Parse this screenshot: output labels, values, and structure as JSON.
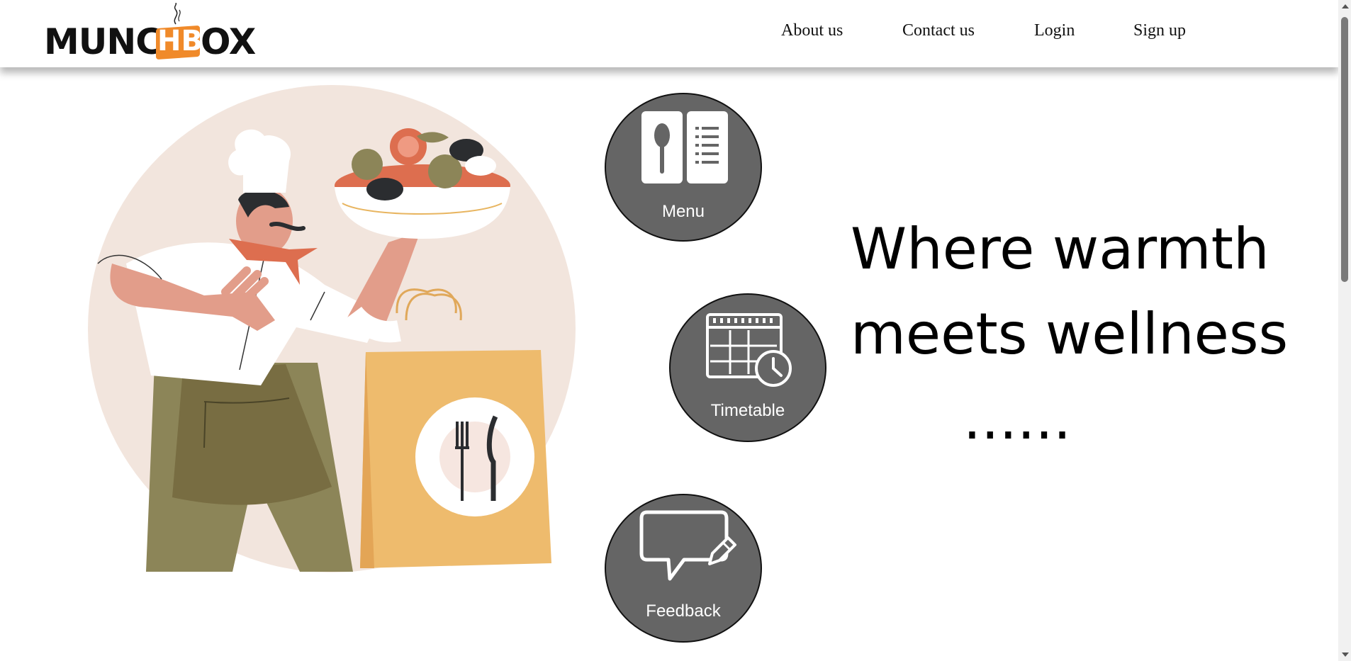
{
  "brand": {
    "name_left": "MUNC",
    "name_box": "HB",
    "name_right": "OX",
    "accent_color": "#f08a2a"
  },
  "nav": {
    "links": [
      "About us",
      "Contact us",
      "Login",
      "Sign up"
    ]
  },
  "features": [
    {
      "label": "Menu",
      "icon": "menu-book-icon"
    },
    {
      "label": "Timetable",
      "icon": "calendar-clock-icon"
    },
    {
      "label": "Feedback",
      "icon": "feedback-pencil-icon"
    }
  ],
  "hero": {
    "tagline_line1": "Where warmth",
    "tagline_line2": "meets wellness",
    "tagline_line3": "......",
    "illustration": "chef-with-salad-and-takeout-bag"
  },
  "colors": {
    "button_bg": "#656565",
    "hero_circle": "#f2e5dd",
    "bag": "#eebb6d",
    "apron": "#786d42"
  }
}
